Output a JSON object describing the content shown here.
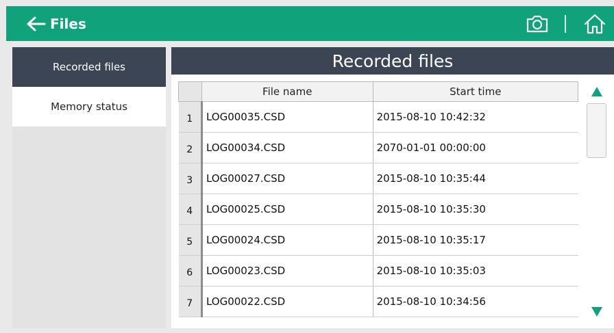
{
  "topbar": {
    "title": "Files",
    "icons": [
      "back-arrow-icon",
      "camera-icon",
      "home-icon"
    ],
    "color": "#10a27a"
  },
  "sidebar": {
    "items": [
      {
        "label": "Recorded files",
        "active": true
      },
      {
        "label": "Memory status",
        "active": false
      }
    ],
    "active_color": "#3c4554"
  },
  "main": {
    "title": "Recorded files",
    "table": {
      "columns": [
        "File name",
        "Start time"
      ],
      "rows": [
        {
          "num": "1",
          "file": "LOG00035.CSD",
          "time": "2015-08-10 10:42:32"
        },
        {
          "num": "2",
          "file": "LOG00034.CSD",
          "time": "2070-01-01 00:00:00"
        },
        {
          "num": "3",
          "file": "LOG00027.CSD",
          "time": "2015-08-10 10:35:44"
        },
        {
          "num": "4",
          "file": "LOG00025.CSD",
          "time": "2015-08-10 10:35:30"
        },
        {
          "num": "5",
          "file": "LOG00024.CSD",
          "time": "2015-08-10 10:35:17"
        },
        {
          "num": "6",
          "file": "LOG00023.CSD",
          "time": "2015-08-10 10:35:03"
        },
        {
          "num": "7",
          "file": "LOG00022.CSD",
          "time": "2015-08-10 10:34:56"
        }
      ]
    },
    "scrollbar": {
      "icons": [
        "scroll-up-icon",
        "scroll-down-icon"
      ],
      "color": "#10a27a"
    }
  }
}
